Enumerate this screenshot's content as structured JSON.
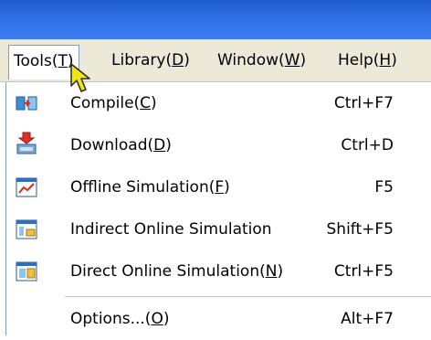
{
  "menubar": {
    "items": [
      {
        "name": "Tools",
        "mnemonic": "T"
      },
      {
        "name": "Library",
        "mnemonic": "D"
      },
      {
        "name": "Window",
        "mnemonic": "W"
      },
      {
        "name": "Help",
        "mnemonic": "H"
      }
    ]
  },
  "tools_menu": {
    "items": [
      {
        "label": "C",
        "pre": "Compile(",
        "post": ")",
        "shortcut": "Ctrl+F7",
        "icon": "compile-icon"
      },
      {
        "label": "D",
        "pre": "Download(",
        "post": ")",
        "shortcut": "Ctrl+D",
        "icon": "download-icon"
      },
      {
        "label": "F",
        "pre": "Offline Simulation(",
        "post": ")",
        "shortcut": "F5",
        "icon": "offline-simulation-icon"
      },
      {
        "label": "",
        "pre": "Indirect Online Simulation",
        "post": "",
        "shortcut": "Shift+F5",
        "icon": "indirect-online-simulation-icon"
      },
      {
        "label": "N",
        "pre": "Direct Online Simulation(",
        "post": ")",
        "shortcut": "Ctrl+F5",
        "icon": "direct-online-simulation-icon"
      },
      {
        "label": "O",
        "pre": "Options...(",
        "post": ")",
        "shortcut": "Alt+F7",
        "icon": ""
      }
    ]
  },
  "colors": {
    "titlebar": "#2f6fe4",
    "menubar_bg": "#ece9d8",
    "cursor": "#f2e60c"
  }
}
